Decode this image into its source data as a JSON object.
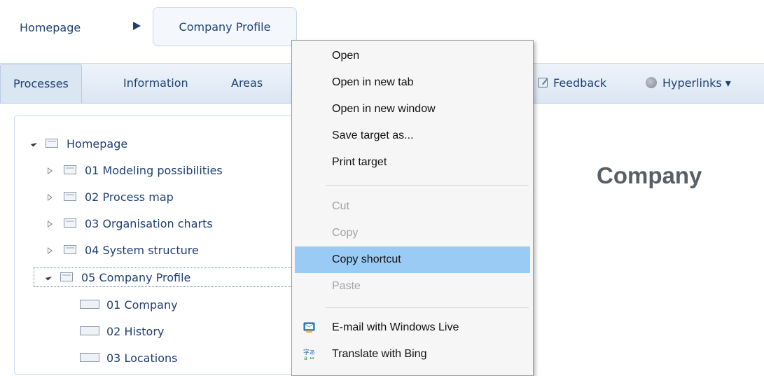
{
  "breadcrumb": {
    "home": "Homepage",
    "current": "Company Profile"
  },
  "nav": {
    "tabs": [
      "Processes",
      "Information",
      "Areas"
    ],
    "feedback": "Feedback",
    "hyperlinks": "Hyperlinks ▾"
  },
  "tree": {
    "root": "Homepage",
    "items": [
      "01 Modeling possibilities",
      "02 Process map",
      "03 Organisation charts",
      "04 System structure",
      "05 Company Profile"
    ],
    "children": [
      "01 Company",
      "02 History",
      "03 Locations"
    ]
  },
  "content": {
    "title": "Company"
  },
  "context_menu": {
    "open": "Open",
    "open_new_tab": "Open in new tab",
    "open_new_window": "Open in new window",
    "save_target": "Save target as...",
    "print_target": "Print target",
    "cut": "Cut",
    "copy": "Copy",
    "copy_shortcut": "Copy shortcut",
    "paste": "Paste",
    "email_live": "E-mail with Windows Live",
    "translate_bing": "Translate with Bing"
  },
  "colors": {
    "accent": "#1f3f73",
    "menu_highlight": "#99cbf5",
    "disabled": "#a3a3a3"
  }
}
